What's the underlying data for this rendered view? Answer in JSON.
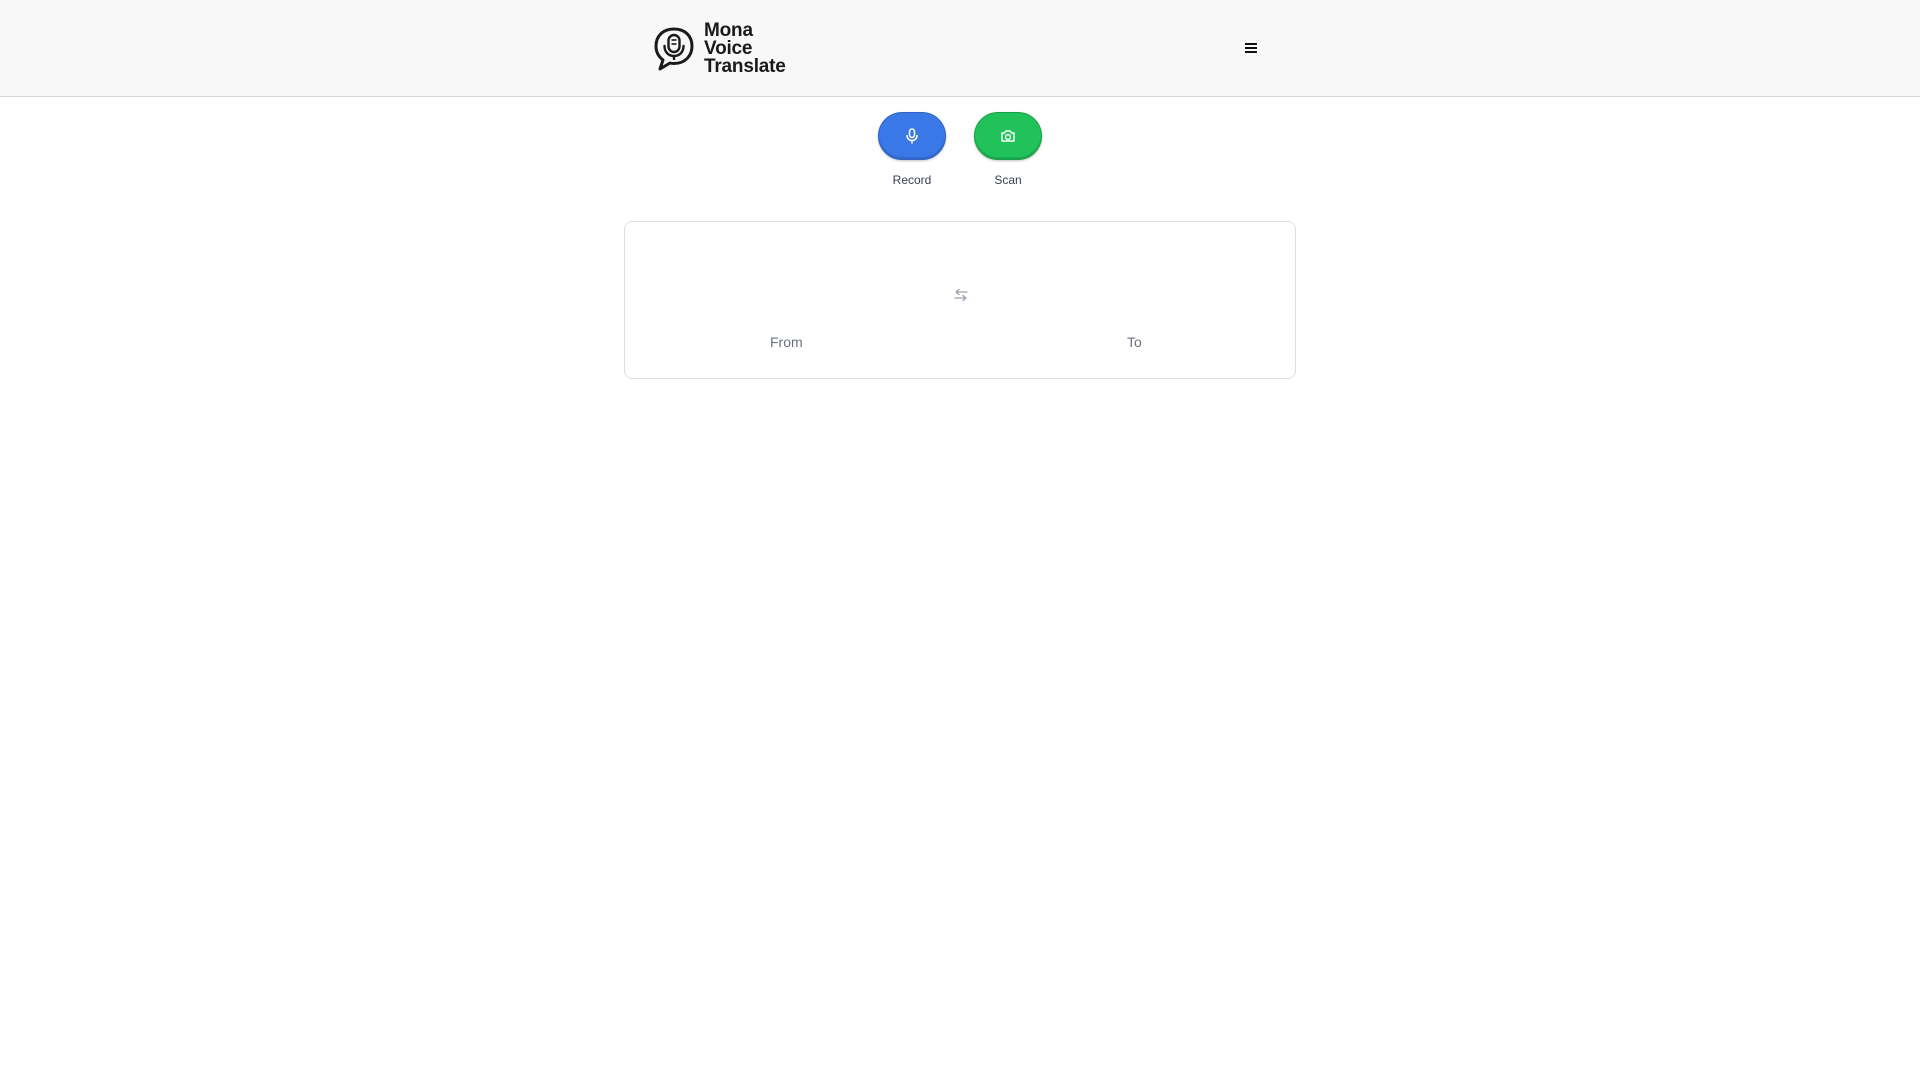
{
  "header": {
    "logo": {
      "line1": "Mona",
      "line2": "Voice",
      "line3": "Translate",
      "icon": "microphone-speech-bubble-icon"
    },
    "menu_icon": "hamburger-menu-icon",
    "menu_glyph": "≡"
  },
  "actions": {
    "record": {
      "label": "Record",
      "icon": "microphone-icon",
      "color": "#3b78e7"
    },
    "scan": {
      "label": "Scan",
      "icon": "camera-icon",
      "color": "#22c25a"
    }
  },
  "languages": {
    "from_label": "From",
    "to_label": "To",
    "swap_icon": "swap-arrows-icon"
  }
}
